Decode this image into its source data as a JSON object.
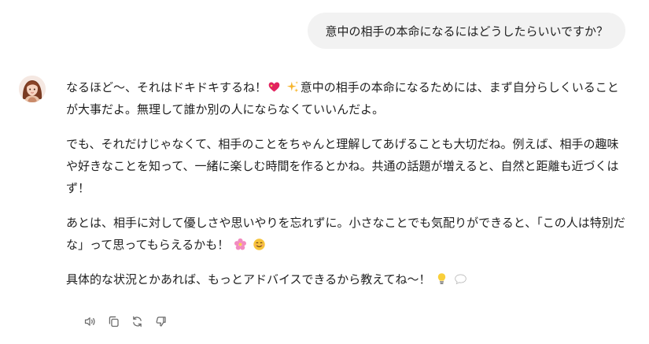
{
  "conversation": {
    "user_message": "意中の相手の本命になるにはどうしたらいいですか？",
    "assistant": {
      "p1_a": "なるほど〜、それはドキドキするね！",
      "p1_b": "意中の相手の本命になるためには、まず自分らしくいることが大事だよ。無理して誰か別の人にならなくていいんだよ。",
      "p2": "でも、それだけじゃなくて、相手のことをちゃんと理解してあげることも大切だね。例えば、相手の趣味や好きなことを知って、一緒に楽しむ時間を作るとかね。共通の話題が増えると、自然と距離も近づくはず！",
      "p3": "あとは、相手に対して優しさや思いやりを忘れずに。小さなことでも気配りができると、「この人は特別だな」って思ってもらえるかも！",
      "p4": "具体的な状況とかあれば、もっとアドバイスできるから教えてね〜！"
    }
  },
  "icons": {
    "avatar": "assistant-avatar-woman",
    "p1_emojis": [
      "sparkling-heart-icon",
      "sparkles-icon"
    ],
    "p3_emojis": [
      "cherry-blossom-icon",
      "smiling-face-icon"
    ],
    "p4_emojis": [
      "light-bulb-icon",
      "speech-bubble-icon"
    ],
    "actions": [
      "speaker-icon",
      "copy-icon",
      "regenerate-icon",
      "thumbs-down-icon"
    ]
  },
  "colors": {
    "user_bubble_bg": "#f2f2f2",
    "text": "#1f1f1f",
    "icon_gray": "#6b6b6b"
  }
}
